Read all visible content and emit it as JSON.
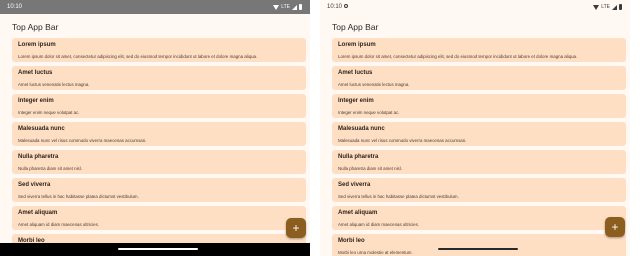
{
  "left": {
    "status": {
      "time": "10:10",
      "network": "LTE"
    },
    "title": "Top App Bar",
    "fab_label": "+",
    "items": [
      {
        "headline": "Lorem ipsum",
        "supporting": "Lorem ipsum dolor sit amet, consectetur adipiscing elit, sed do eiusmod tempor incididunt ut labore et dolore magna aliqua."
      },
      {
        "headline": "Amet luctus",
        "supporting": "Amet luctus venenatis lectus magna."
      },
      {
        "headline": "Integer enim",
        "supporting": "Integer enim neque volutpat ac."
      },
      {
        "headline": "Malesuada nunc",
        "supporting": "Malesuada nunc vel risus commodo viverra maecenas accumsan."
      },
      {
        "headline": "Nulla pharetra",
        "supporting": "Nulla pharetra diam sit amet nisl."
      },
      {
        "headline": "Sed viverra",
        "supporting": "Sed viverra tellus in hac habitasse platea dictumst vestibulum."
      },
      {
        "headline": "Amet aliquam",
        "supporting": "Amet aliquam id diam maecenas ultricies."
      },
      {
        "headline": "Morbi leo",
        "supporting": ""
      }
    ]
  },
  "right": {
    "status": {
      "time": "10:10",
      "network": "LTE"
    },
    "title": "Top App Bar",
    "fab_label": "+",
    "items": [
      {
        "headline": "Lorem ipsum",
        "supporting": "Lorem ipsum dolor sit amet, consectetur adipiscing elit, sed do eiusmod tempor incididunt ut labore et dolore magna aliqua."
      },
      {
        "headline": "Amet luctus",
        "supporting": "Amet luctus venenatis lectus magna."
      },
      {
        "headline": "Integer enim",
        "supporting": "Integer enim neque volutpat ac."
      },
      {
        "headline": "Malesuada nunc",
        "supporting": "Malesuada nunc vel risus commodo viverra maecenas accumsan."
      },
      {
        "headline": "Nulla pharetra",
        "supporting": "Nulla pharetra diam sit amet nisl."
      },
      {
        "headline": "Sed viverra",
        "supporting": "Sed viverra tellus in hac habitasse platea dictumst vestibulum."
      },
      {
        "headline": "Amet aliquam",
        "supporting": "Amet aliquam id diam maecenas ultricies."
      },
      {
        "headline": "Morbi leo",
        "supporting": "Morbi leo urna molestie at elementum."
      }
    ]
  },
  "colors": {
    "background": "#fff8f3",
    "card": "#ffdfc4",
    "fab": "#8b5e1f",
    "left_status_bar": "#777777",
    "left_nav_bar": "#000000"
  },
  "icons": {
    "fab": "add-icon",
    "status": [
      "wifi-icon",
      "signal-icon",
      "battery-icon"
    ]
  }
}
